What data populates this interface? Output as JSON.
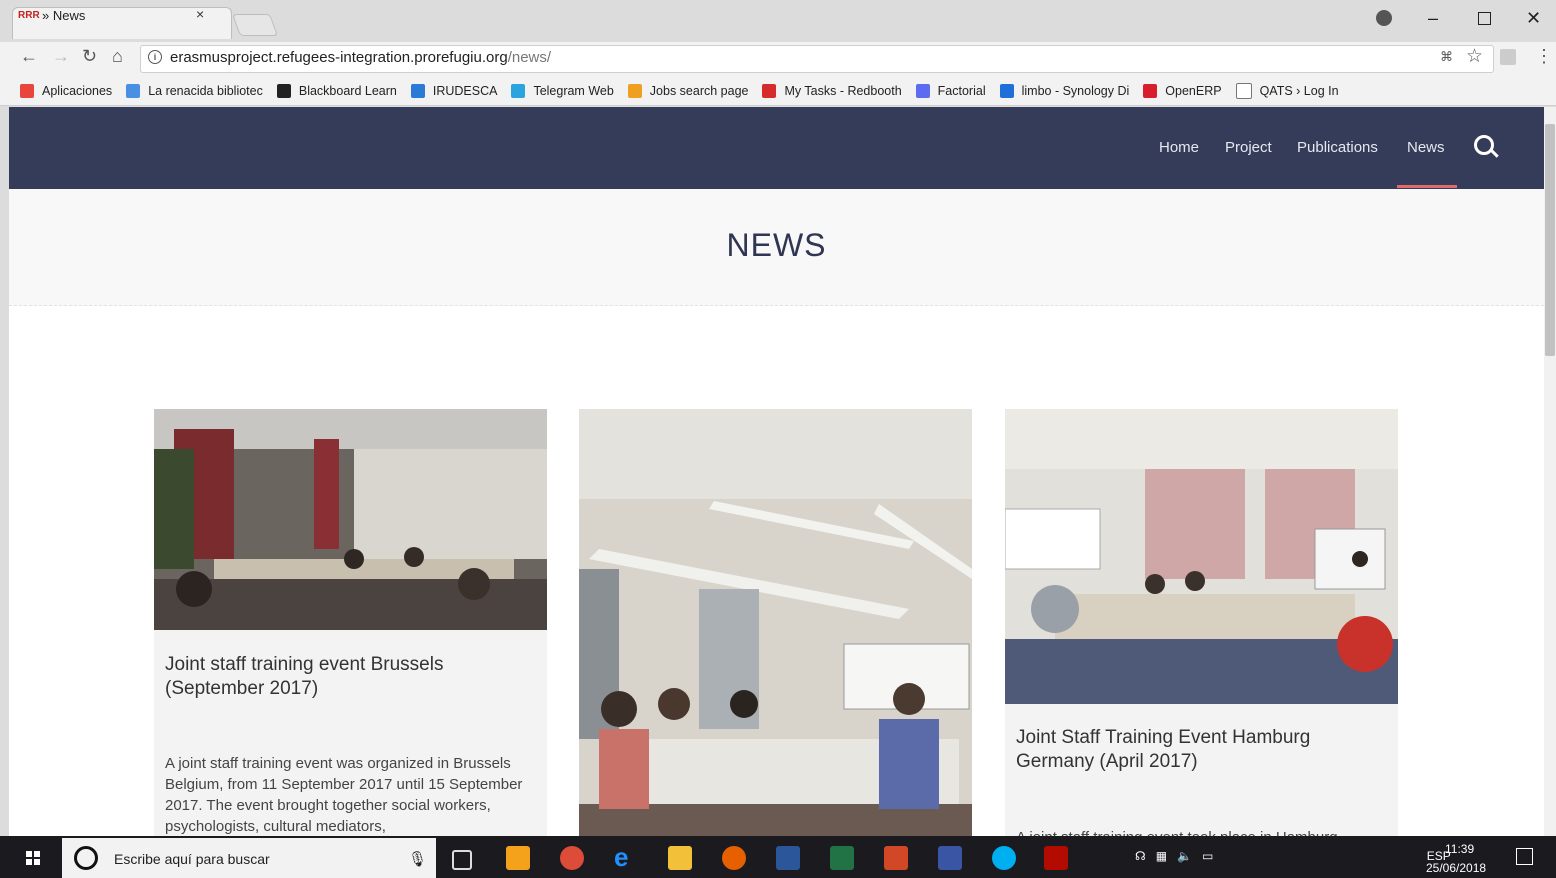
{
  "browser": {
    "tab_title": "» News",
    "tab_favicon": "RRR",
    "tab_close": "×",
    "url_host": "erasmusproject.refugees-integration.prorefugiu.org",
    "url_path": "/news/",
    "bookmarks": [
      {
        "label": "Aplicaciones",
        "icon": "apps-grid-icon",
        "color": "#e8453c"
      },
      {
        "label": "La renacida bibliotec",
        "icon": "library-icon",
        "color": "#4a90e2"
      },
      {
        "label": "Blackboard Learn",
        "icon": "blackboard-icon",
        "color": "#222222"
      },
      {
        "label": "IRUDESCA",
        "icon": "irudesca-icon",
        "color": "#2b7bd6"
      },
      {
        "label": "Telegram Web",
        "icon": "telegram-icon",
        "color": "#2aa3de"
      },
      {
        "label": "Jobs search page",
        "icon": "jobs-icon",
        "color": "#f0a020"
      },
      {
        "label": "My Tasks - Redbooth",
        "icon": "redbooth-icon",
        "color": "#d52b2b"
      },
      {
        "label": "Factorial",
        "icon": "factorial-icon",
        "color": "#5b6cf0"
      },
      {
        "label": "limbo - Synology Di",
        "icon": "synology-icon",
        "color": "#1e6fd9"
      },
      {
        "label": "OpenERP",
        "icon": "opera-icon",
        "color": "#d81e2c"
      },
      {
        "label": "QATS › Log In",
        "icon": "page-icon",
        "color": "#ffffff"
      }
    ]
  },
  "site": {
    "nav": [
      {
        "label": "Home"
      },
      {
        "label": "Project"
      },
      {
        "label": "Publications"
      },
      {
        "label": "News"
      }
    ],
    "active_nav": "News",
    "page_title": "NEWS",
    "cards": [
      {
        "title": "Joint staff training event Brussels (September 2017)",
        "excerpt": "A joint staff training event was organized in Brussels Belgium, from 11 September 2017 until 15 September 2017. The event brought together social workers, psychologists, cultural mediators,"
      },
      {
        "title": "",
        "excerpt": ""
      },
      {
        "title": "Joint Staff Training Event Hamburg Germany (April 2017)",
        "excerpt": "A joint staff training event took place in Hamburg"
      }
    ]
  },
  "taskbar": {
    "search_placeholder": "Escribe aquí para buscar",
    "language": "ESP",
    "time": "11:39",
    "date": "25/06/2018"
  },
  "colors": {
    "nav_bg": "#353c5a",
    "nav_active_underline": "#e06b6b",
    "title_color": "#2f3552"
  }
}
